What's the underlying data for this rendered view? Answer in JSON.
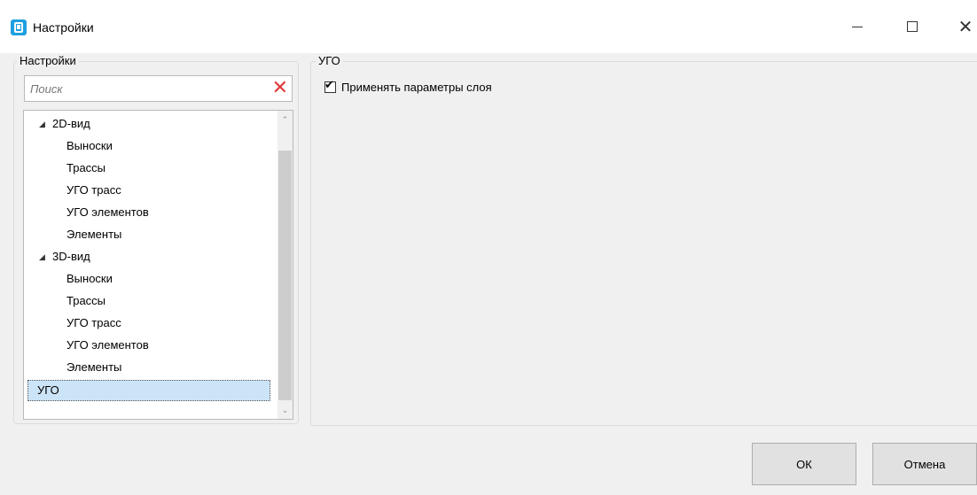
{
  "window": {
    "title": "Настройки",
    "controls": {
      "minimize": "minimize-icon",
      "maximize": "maximize-icon",
      "close": "close-icon"
    }
  },
  "left_panel": {
    "legend": "Настройки",
    "search_placeholder": "Поиск",
    "tree": {
      "groups": [
        {
          "label": "2D-вид",
          "children": [
            "Выноски",
            "Трассы",
            "УГО трасс",
            "УГО элементов",
            "Элементы"
          ]
        },
        {
          "label": "3D-вид",
          "children": [
            "Выноски",
            "Трассы",
            "УГО трасс",
            "УГО элементов",
            "Элементы"
          ]
        }
      ],
      "selected": "УГО"
    }
  },
  "right_panel": {
    "legend": "УГО",
    "checkbox_label": "Применять параметры слоя",
    "checkbox_checked": true
  },
  "buttons": {
    "ok": "ОК",
    "cancel": "Отмена"
  },
  "colors": {
    "accent": "#1e9fe0",
    "selection": "#cce4f7",
    "clear_icon": "#e03a3a"
  }
}
